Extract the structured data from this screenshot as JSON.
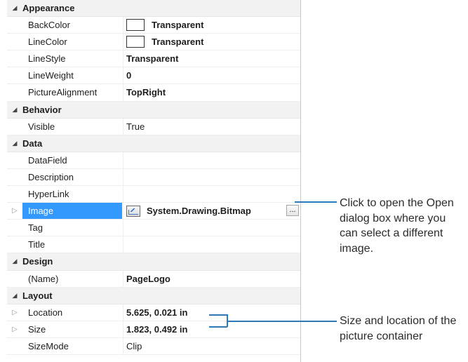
{
  "rows": [
    {
      "type": "cat",
      "label": "Appearance"
    },
    {
      "type": "prop",
      "name": "BackColor",
      "value": "Transparent",
      "swatch": true,
      "bold": true
    },
    {
      "type": "prop",
      "name": "LineColor",
      "value": "Transparent",
      "swatch": true,
      "bold": true
    },
    {
      "type": "prop",
      "name": "LineStyle",
      "value": "Transparent",
      "bold": true
    },
    {
      "type": "prop",
      "name": "LineWeight",
      "value": "0",
      "bold": true
    },
    {
      "type": "prop",
      "name": "PictureAlignment",
      "value": "TopRight",
      "bold": true
    },
    {
      "type": "cat",
      "label": "Behavior"
    },
    {
      "type": "prop",
      "name": "Visible",
      "value": "True",
      "bold": false
    },
    {
      "type": "cat",
      "label": "Data"
    },
    {
      "type": "prop",
      "name": "DataField",
      "value": ""
    },
    {
      "type": "prop",
      "name": "Description",
      "value": ""
    },
    {
      "type": "prop",
      "name": "HyperLink",
      "value": ""
    },
    {
      "type": "prop",
      "name": "Image",
      "value": "System.Drawing.Bitmap",
      "bold": true,
      "selected": true,
      "expander": true,
      "bitmap_icon": true,
      "ellipsis": "..."
    },
    {
      "type": "prop",
      "name": "Tag",
      "value": ""
    },
    {
      "type": "prop",
      "name": "Title",
      "value": ""
    },
    {
      "type": "cat",
      "label": "Design"
    },
    {
      "type": "prop",
      "name": "(Name)",
      "value": "PageLogo",
      "bold": true
    },
    {
      "type": "cat",
      "label": "Layout"
    },
    {
      "type": "prop",
      "name": "Location",
      "value": "5.625, 0.021 in",
      "bold": true,
      "expander": true
    },
    {
      "type": "prop",
      "name": "Size",
      "value": "1.823, 0.492 in",
      "bold": true,
      "expander": true
    },
    {
      "type": "prop",
      "name": "SizeMode",
      "value": "Clip",
      "bold": false
    }
  ],
  "icons": {
    "collapse": "◢",
    "expand": "▷"
  },
  "callouts": {
    "image_note": "Click to open the Open dialog box where you can select a different image.",
    "layout_note": "Size and location of the picture container"
  },
  "colors": {
    "selection": "#3399ff",
    "callout_line": "#2f79b8"
  }
}
